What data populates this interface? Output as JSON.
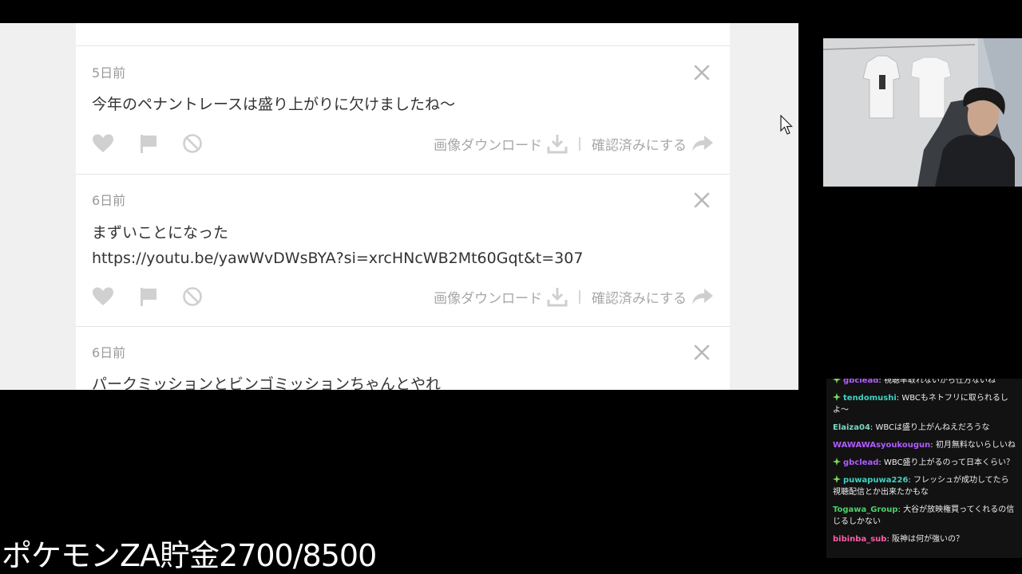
{
  "feed": {
    "cards": [
      {
        "time": "5日前",
        "message": "今年のペナントレースは盛り上がりに欠けましたね～",
        "download_label": "画像ダウンロード",
        "confirm_label": "確認済みにする"
      },
      {
        "time": "6日前",
        "message": "まずいことになった",
        "link": "https://youtu.be/yawWvDWsBYA?si=xrcHNcWB2Mt60Gqt&t=307",
        "download_label": "画像ダウンロード",
        "confirm_label": "確認済みにする"
      },
      {
        "time": "6日前",
        "message": "パークミッションとビンゴミッションちゃんとやれ"
      }
    ],
    "separator": "|"
  },
  "chat": {
    "messages": [
      {
        "user": "gbclead",
        "text": "視聴率取れないから仕方ないね",
        "badge": true,
        "color": "#b15cff"
      },
      {
        "user": "tendomushi",
        "text": "WBCもネトフリに取られるしよ～",
        "badge": true,
        "color": "#3fd1c2"
      },
      {
        "user": "Elaiza04",
        "text": "WBCは盛り上がんねえだろうな",
        "badge": false,
        "color": "#7ad7c4"
      },
      {
        "user": "WAWAWAsyoukougun",
        "text": "初月無料ないらしいね",
        "badge": false,
        "color": "#b15cff"
      },
      {
        "user": "gbclead",
        "text": "WBC盛り上がるのって日本くらい？",
        "badge": true,
        "color": "#b15cff"
      },
      {
        "user": "puwapuwa226",
        "text": "フレッシュが成功してたら視聴配信とか出来たかもな",
        "badge": true,
        "color": "#3fd1c2"
      },
      {
        "user": "Togawa_Group",
        "text": "大谷が放映権買ってくれるの信じるしかない",
        "badge": false,
        "color": "#4ccf6a"
      },
      {
        "user": "bibinba_sub",
        "text": "阪神は何が強いの？",
        "badge": false,
        "color": "#ff5ca8"
      }
    ]
  },
  "overlay": {
    "title": "ポケモンZA貯金2700/8500"
  },
  "colors": {
    "icon_gray": "#cfcfcf",
    "text_gray": "#9a9a9a",
    "badge_green": "#7ed957"
  }
}
